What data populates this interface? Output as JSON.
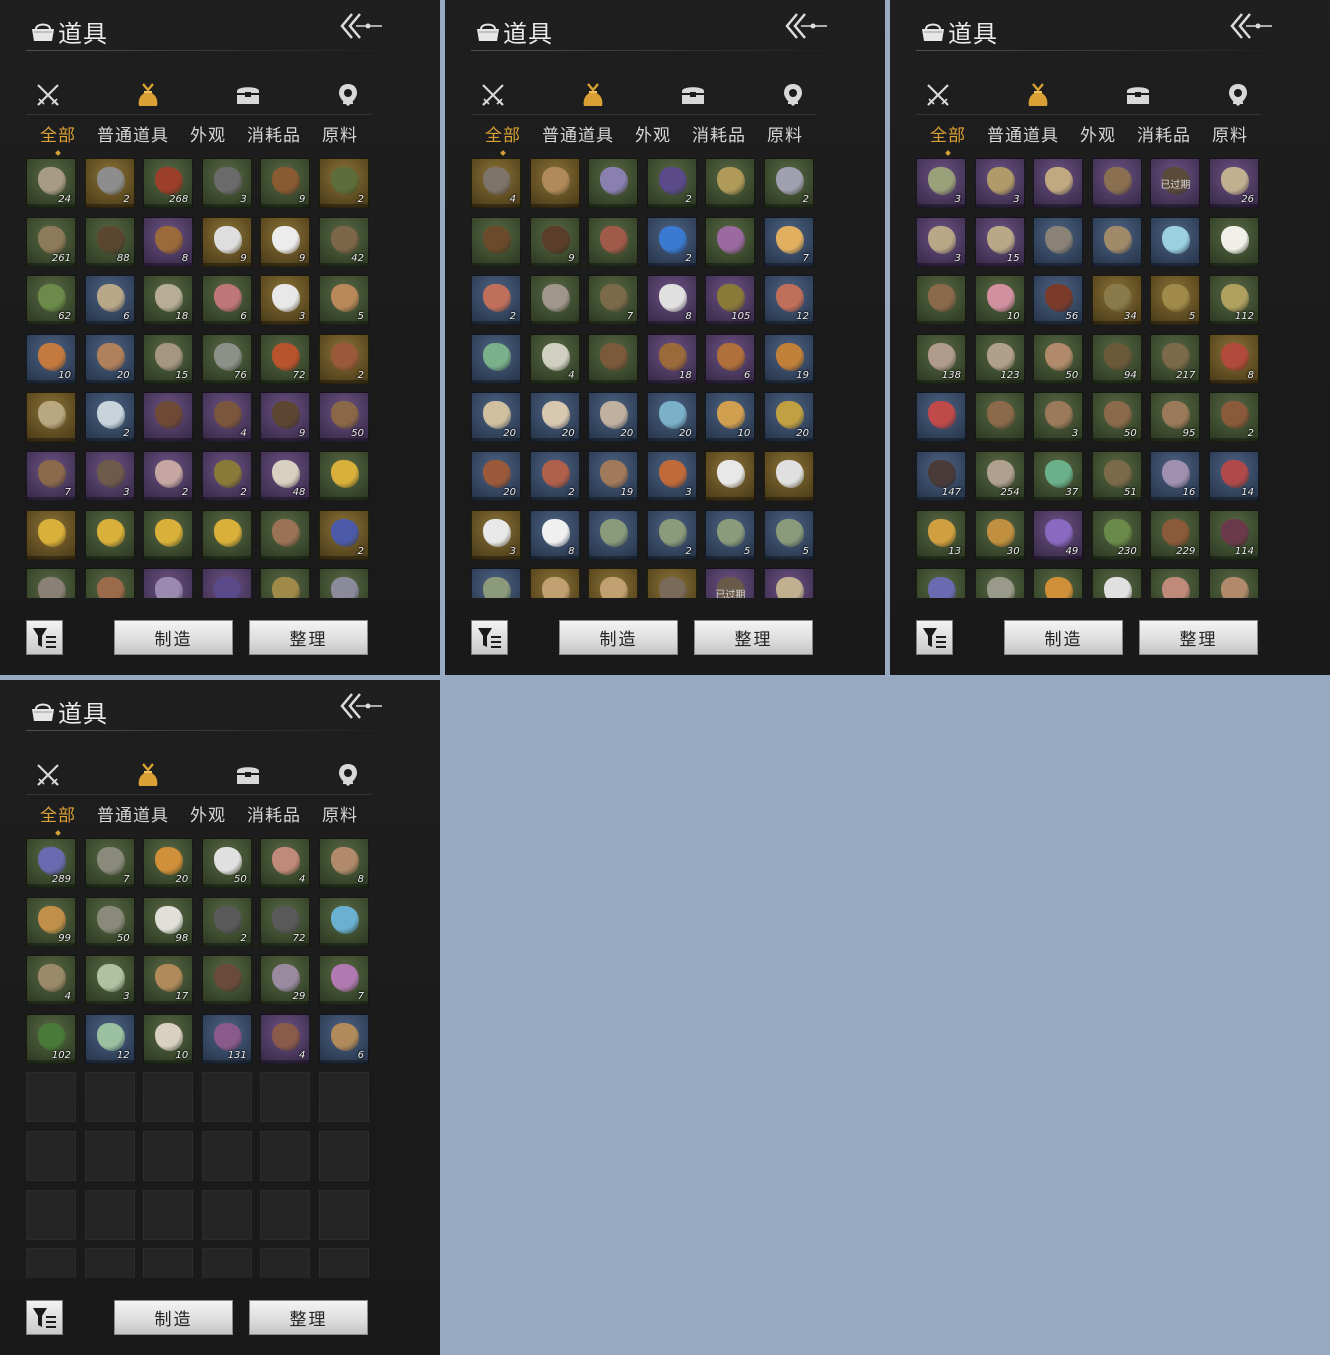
{
  "colors": {
    "background": "#97aac2",
    "panel": "#1c1c1c",
    "accent_gold": "#d9a135",
    "rarity_green": "#3c4a2e",
    "rarity_blue": "#34455f",
    "rarity_purple": "#4a385d",
    "rarity_gold": "#614e22"
  },
  "panels": [
    {
      "title": "道具",
      "back_icon": "double-chevron-left-icon",
      "icon_tabs": [
        "crossed-swords-icon",
        "pouch-icon",
        "chest-icon",
        "pin-icon"
      ],
      "active_icon_tab": 1,
      "tabs": [
        "全部",
        "普通道具",
        "外观",
        "消耗品",
        "原料"
      ],
      "active_tab": 0,
      "craft_label": "制造",
      "sort_label": "整理",
      "filter_icon": "filter-list-icon",
      "items": [
        {
          "r": "green",
          "q": "24",
          "c": "#a89b85"
        },
        {
          "r": "gold",
          "q": "2",
          "c": "#8d8d8d"
        },
        {
          "r": "green",
          "q": "268",
          "c": "#9b3f2a"
        },
        {
          "r": "green",
          "q": "3",
          "c": "#6b6b6b"
        },
        {
          "r": "green",
          "q": "9",
          "c": "#8a5a33"
        },
        {
          "r": "gold",
          "q": "2",
          "c": "#5e6e3a"
        },
        {
          "r": "green",
          "q": "261",
          "c": "#8d7a5a"
        },
        {
          "r": "green",
          "q": "88",
          "c": "#5b4730"
        },
        {
          "r": "purple",
          "q": "8",
          "c": "#9b6a3a"
        },
        {
          "r": "gold",
          "q": "9",
          "c": "#dedede"
        },
        {
          "r": "gold",
          "q": "9",
          "c": "#ececec"
        },
        {
          "r": "green",
          "q": "42",
          "c": "#7d6547"
        },
        {
          "r": "green",
          "q": "62",
          "c": "#6c8a4a"
        },
        {
          "r": "blue",
          "q": "6",
          "c": "#b8a789"
        },
        {
          "r": "green",
          "q": "18",
          "c": "#b6ad94"
        },
        {
          "r": "green",
          "q": "6",
          "c": "#c07777"
        },
        {
          "r": "gold",
          "q": "3",
          "c": "#e8e8e8"
        },
        {
          "r": "green",
          "q": "5",
          "c": "#b8875a"
        },
        {
          "r": "blue",
          "q": "10",
          "c": "#c47a3f"
        },
        {
          "r": "blue",
          "q": "20",
          "c": "#b0805a"
        },
        {
          "r": "green",
          "q": "15",
          "c": "#a49680"
        },
        {
          "r": "green",
          "q": "76",
          "c": "#8c9088"
        },
        {
          "r": "green",
          "q": "72",
          "c": "#b8542d"
        },
        {
          "r": "gold",
          "q": "2",
          "c": "#9a5a3a"
        },
        {
          "r": "gold",
          "q": "",
          "c": "#b9a780"
        },
        {
          "r": "blue",
          "q": "2",
          "c": "#c8d3dc"
        },
        {
          "r": "purple",
          "q": "",
          "c": "#6e4a36"
        },
        {
          "r": "purple",
          "q": "4",
          "c": "#7a563d"
        },
        {
          "r": "purple",
          "q": "9",
          "c": "#5d4631"
        },
        {
          "r": "purple",
          "q": "50",
          "c": "#8a6747"
        },
        {
          "r": "purple",
          "q": "7",
          "c": "#8a6a4a"
        },
        {
          "r": "purple",
          "q": "3",
          "c": "#6d5a4b"
        },
        {
          "r": "purple",
          "q": "2",
          "c": "#c5a6a0"
        },
        {
          "r": "purple",
          "q": "2",
          "c": "#8a7a3a"
        },
        {
          "r": "purple",
          "q": "48",
          "c": "#d8d0c0"
        },
        {
          "r": "green",
          "q": "",
          "c": "#d8b03a"
        },
        {
          "r": "gold",
          "q": "",
          "c": "#d8b03a"
        },
        {
          "r": "green",
          "q": "",
          "c": "#d8b03a"
        },
        {
          "r": "green",
          "q": "",
          "c": "#d8b03a"
        },
        {
          "r": "green",
          "q": "",
          "c": "#d8b03a"
        },
        {
          "r": "green",
          "q": "",
          "c": "#9a7255"
        },
        {
          "r": "gold",
          "q": "2",
          "c": "#4a5aa8"
        },
        {
          "r": "green",
          "q": "",
          "c": "#8a8076"
        },
        {
          "r": "green",
          "q": "",
          "c": "#9a6a4a"
        },
        {
          "r": "purple",
          "q": "",
          "c": "#9a8ab0"
        },
        {
          "r": "purple",
          "q": "",
          "c": "#5a4a8a"
        },
        {
          "r": "green",
          "q": "",
          "c": "#a08a4a"
        },
        {
          "r": "green",
          "q": "",
          "c": "#8a8a9a"
        }
      ]
    },
    {
      "title": "道具",
      "back_icon": "double-chevron-left-icon",
      "icon_tabs": [
        "crossed-swords-icon",
        "pouch-icon",
        "chest-icon",
        "pin-icon"
      ],
      "active_icon_tab": 1,
      "tabs": [
        "全部",
        "普通道具",
        "外观",
        "消耗品",
        "原料"
      ],
      "active_tab": 0,
      "craft_label": "制造",
      "sort_label": "整理",
      "filter_icon": "filter-list-icon",
      "items": [
        {
          "r": "gold",
          "q": "4",
          "c": "#7c7468"
        },
        {
          "r": "gold",
          "q": "",
          "c": "#b08a5a"
        },
        {
          "r": "green",
          "q": "",
          "c": "#8a80b0"
        },
        {
          "r": "green",
          "q": "2",
          "c": "#5a4a8a"
        },
        {
          "r": "green",
          "q": "",
          "c": "#b09a5a"
        },
        {
          "r": "green",
          "q": "2",
          "c": "#a0a0b0"
        },
        {
          "r": "green",
          "q": "",
          "c": "#6a4a2a"
        },
        {
          "r": "green",
          "q": "9",
          "c": "#5a3e2a"
        },
        {
          "r": "green",
          "q": "",
          "c": "#a05a4a"
        },
        {
          "r": "blue",
          "q": "2",
          "c": "#3a7ad0"
        },
        {
          "r": "green",
          "q": "",
          "c": "#9a6aa0"
        },
        {
          "r": "blue",
          "q": "7",
          "c": "#e0b060"
        },
        {
          "r": "blue",
          "q": "2",
          "c": "#c0705a"
        },
        {
          "r": "green",
          "q": "",
          "c": "#a0968a"
        },
        {
          "r": "green",
          "q": "7",
          "c": "#7a6a4a"
        },
        {
          "r": "purple",
          "q": "8",
          "c": "#e0e0e0"
        },
        {
          "r": "purple",
          "q": "105",
          "c": "#8a7a3a"
        },
        {
          "r": "blue",
          "q": "12",
          "c": "#c0705a"
        },
        {
          "r": "blue",
          "q": "",
          "c": "#7ab08a"
        },
        {
          "r": "green",
          "q": "4",
          "c": "#d0d0c0"
        },
        {
          "r": "green",
          "q": "",
          "c": "#7a5a3a"
        },
        {
          "r": "purple",
          "q": "18",
          "c": "#9a6a3a"
        },
        {
          "r": "purple",
          "q": "6",
          "c": "#b0703a"
        },
        {
          "r": "blue",
          "q": "19",
          "c": "#c0803a"
        },
        {
          "r": "blue",
          "q": "20",
          "c": "#d0c0a0"
        },
        {
          "r": "blue",
          "q": "20",
          "c": "#d8c8b0"
        },
        {
          "r": "blue",
          "q": "20",
          "c": "#c0b0a0"
        },
        {
          "r": "blue",
          "q": "20",
          "c": "#7ab0c8"
        },
        {
          "r": "blue",
          "q": "10",
          "c": "#d0a050"
        },
        {
          "r": "blue",
          "q": "20",
          "c": "#c0a040"
        },
        {
          "r": "blue",
          "q": "20",
          "c": "#9a5a3a"
        },
        {
          "r": "blue",
          "q": "2",
          "c": "#b0604a"
        },
        {
          "r": "blue",
          "q": "19",
          "c": "#a07a5a"
        },
        {
          "r": "blue",
          "q": "3",
          "c": "#c06a3a"
        },
        {
          "r": "gold",
          "q": "",
          "c": "#e8e8e8"
        },
        {
          "r": "gold",
          "q": "",
          "c": "#e0e0e0"
        },
        {
          "r": "gold",
          "q": "3",
          "c": "#e8e8e8"
        },
        {
          "r": "blue",
          "q": "8",
          "c": "#f0f0f0"
        },
        {
          "r": "blue",
          "q": "",
          "c": "#8a9a7a"
        },
        {
          "r": "blue",
          "q": "2",
          "c": "#8a9a7a"
        },
        {
          "r": "blue",
          "q": "5",
          "c": "#8a9a7a"
        },
        {
          "r": "blue",
          "q": "5",
          "c": "#8a9a7a"
        },
        {
          "r": "blue",
          "q": "",
          "c": "#8a9a7a"
        },
        {
          "r": "gold",
          "q": "",
          "c": "#c0a070"
        },
        {
          "r": "gold",
          "q": "",
          "c": "#c0a070"
        },
        {
          "r": "gold",
          "q": "",
          "c": "#7a6a5a"
        },
        {
          "r": "purple",
          "q": "",
          "c": "#6a5a4a",
          "x": "已过期"
        },
        {
          "r": "purple",
          "q": "",
          "c": "#c0b090"
        }
      ]
    },
    {
      "title": "道具",
      "back_icon": "double-chevron-left-icon",
      "icon_tabs": [
        "crossed-swords-icon",
        "pouch-icon",
        "chest-icon",
        "pin-icon"
      ],
      "active_icon_tab": 1,
      "tabs": [
        "全部",
        "普通道具",
        "外观",
        "消耗品",
        "原料"
      ],
      "active_tab": 0,
      "craft_label": "制造",
      "sort_label": "整理",
      "filter_icon": "filter-list-icon",
      "items": [
        {
          "r": "purple",
          "q": "3",
          "c": "#9aa07a"
        },
        {
          "r": "purple",
          "q": "3",
          "c": "#b09a6a"
        },
        {
          "r": "purple",
          "q": "",
          "c": "#c0a880"
        },
        {
          "r": "purple",
          "q": "",
          "c": "#8a7050"
        },
        {
          "r": "purple",
          "q": "",
          "c": "#5a4a3a",
          "x": "已过期"
        },
        {
          "r": "purple",
          "q": "26",
          "c": "#c0b090"
        },
        {
          "r": "purple",
          "q": "3",
          "c": "#b8a888"
        },
        {
          "r": "purple",
          "q": "15",
          "c": "#b8a888"
        },
        {
          "r": "blue",
          "q": "",
          "c": "#8a8276"
        },
        {
          "r": "blue",
          "q": "",
          "c": "#a08a6a"
        },
        {
          "r": "blue",
          "q": "",
          "c": "#9ad0e0"
        },
        {
          "r": "green",
          "q": "",
          "c": "#f0f0e8"
        },
        {
          "r": "green",
          "q": "",
          "c": "#8a6a4a"
        },
        {
          "r": "green",
          "q": "10",
          "c": "#d090a0"
        },
        {
          "r": "blue",
          "q": "56",
          "c": "#7a3a2a"
        },
        {
          "r": "gold",
          "q": "34",
          "c": "#8a7a4a"
        },
        {
          "r": "gold",
          "q": "5",
          "c": "#a08a4a"
        },
        {
          "r": "green",
          "q": "112",
          "c": "#b0a060"
        },
        {
          "r": "green",
          "q": "138",
          "c": "#b09a8a"
        },
        {
          "r": "green",
          "q": "123",
          "c": "#b0a08a"
        },
        {
          "r": "green",
          "q": "50",
          "c": "#b08a6a"
        },
        {
          "r": "green",
          "q": "94",
          "c": "#6a5a3a"
        },
        {
          "r": "green",
          "q": "217",
          "c": "#7a6a4a"
        },
        {
          "r": "gold",
          "q": "8",
          "c": "#b04a3a"
        },
        {
          "r": "blue",
          "q": "",
          "c": "#c04a4a"
        },
        {
          "r": "green",
          "q": "",
          "c": "#8a6a4a"
        },
        {
          "r": "green",
          "q": "3",
          "c": "#9a7a5a"
        },
        {
          "r": "green",
          "q": "50",
          "c": "#8a6a4a"
        },
        {
          "r": "green",
          "q": "95",
          "c": "#9a7a5a"
        },
        {
          "r": "green",
          "q": "2",
          "c": "#8a5a3a"
        },
        {
          "r": "blue",
          "q": "147",
          "c": "#4a3a3a"
        },
        {
          "r": "green",
          "q": "254",
          "c": "#b0a090"
        },
        {
          "r": "green",
          "q": "37",
          "c": "#6ab08a"
        },
        {
          "r": "green",
          "q": "51",
          "c": "#7a6a4a"
        },
        {
          "r": "blue",
          "q": "16",
          "c": "#a090b0"
        },
        {
          "r": "blue",
          "q": "14",
          "c": "#b04a4a"
        },
        {
          "r": "green",
          "q": "13",
          "c": "#d0a040"
        },
        {
          "r": "green",
          "q": "30",
          "c": "#c09040"
        },
        {
          "r": "purple",
          "q": "49",
          "c": "#8a6ac0"
        },
        {
          "r": "green",
          "q": "230",
          "c": "#6a8a4a"
        },
        {
          "r": "green",
          "q": "229",
          "c": "#8a5a3a"
        },
        {
          "r": "green",
          "q": "114",
          "c": "#6a3a4a"
        },
        {
          "r": "green",
          "q": "",
          "c": "#6a6ab0"
        },
        {
          "r": "green",
          "q": "",
          "c": "#9a9a8a"
        },
        {
          "r": "green",
          "q": "",
          "c": "#d0903a"
        },
        {
          "r": "green",
          "q": "",
          "c": "#e0e0e0"
        },
        {
          "r": "green",
          "q": "",
          "c": "#c08a7a"
        },
        {
          "r": "green",
          "q": "",
          "c": "#b08a6a"
        }
      ]
    },
    {
      "title": "道具",
      "back_icon": "double-chevron-left-icon",
      "icon_tabs": [
        "crossed-swords-icon",
        "pouch-icon",
        "chest-icon",
        "pin-icon"
      ],
      "active_icon_tab": 1,
      "tabs": [
        "全部",
        "普通道具",
        "外观",
        "消耗品",
        "原料"
      ],
      "active_tab": 0,
      "craft_label": "制造",
      "sort_label": "整理",
      "filter_icon": "filter-list-icon",
      "items": [
        {
          "r": "green",
          "q": "289",
          "c": "#6a6ab0"
        },
        {
          "r": "green",
          "q": "7",
          "c": "#8a8a7a"
        },
        {
          "r": "green",
          "q": "20",
          "c": "#d0903a"
        },
        {
          "r": "green",
          "q": "50",
          "c": "#e0e0e0"
        },
        {
          "r": "green",
          "q": "4",
          "c": "#c08a7a"
        },
        {
          "r": "green",
          "q": "8",
          "c": "#b08a6a"
        },
        {
          "r": "green",
          "q": "99",
          "c": "#c0904a"
        },
        {
          "r": "green",
          "q": "50",
          "c": "#8a8a7a"
        },
        {
          "r": "green",
          "q": "98",
          "c": "#e0e0d8"
        },
        {
          "r": "green",
          "q": "2",
          "c": "#5a5a5a"
        },
        {
          "r": "green",
          "q": "72",
          "c": "#5a5a5a"
        },
        {
          "r": "green",
          "q": "",
          "c": "#6ab0d0"
        },
        {
          "r": "green",
          "q": "4",
          "c": "#9a8a6a"
        },
        {
          "r": "green",
          "q": "3",
          "c": "#b0c0a0"
        },
        {
          "r": "green",
          "q": "17",
          "c": "#b08a5a"
        },
        {
          "r": "green",
          "q": "",
          "c": "#6a4a3a"
        },
        {
          "r": "green",
          "q": "29",
          "c": "#9a8aa0"
        },
        {
          "r": "green",
          "q": "7",
          "c": "#b07ab0"
        },
        {
          "r": "green",
          "q": "102",
          "c": "#4a7a3a"
        },
        {
          "r": "blue",
          "q": "12",
          "c": "#9ac0a0"
        },
        {
          "r": "green",
          "q": "10",
          "c": "#d8d0c0"
        },
        {
          "r": "blue",
          "q": "131",
          "c": "#8a5a8a"
        },
        {
          "r": "purple",
          "q": "4",
          "c": "#8a5a4a"
        },
        {
          "r": "blue",
          "q": "6",
          "c": "#b08a5a"
        },
        {
          "r": "empty",
          "q": "",
          "c": ""
        },
        {
          "r": "empty",
          "q": "",
          "c": ""
        },
        {
          "r": "empty",
          "q": "",
          "c": ""
        },
        {
          "r": "empty",
          "q": "",
          "c": ""
        },
        {
          "r": "empty",
          "q": "",
          "c": ""
        },
        {
          "r": "empty",
          "q": "",
          "c": ""
        },
        {
          "r": "empty",
          "q": "",
          "c": ""
        },
        {
          "r": "empty",
          "q": "",
          "c": ""
        },
        {
          "r": "empty",
          "q": "",
          "c": ""
        },
        {
          "r": "empty",
          "q": "",
          "c": ""
        },
        {
          "r": "empty",
          "q": "",
          "c": ""
        },
        {
          "r": "empty",
          "q": "",
          "c": ""
        },
        {
          "r": "empty",
          "q": "",
          "c": ""
        },
        {
          "r": "empty",
          "q": "",
          "c": ""
        },
        {
          "r": "empty",
          "q": "",
          "c": ""
        },
        {
          "r": "empty",
          "q": "",
          "c": ""
        },
        {
          "r": "empty",
          "q": "",
          "c": ""
        },
        {
          "r": "empty",
          "q": "",
          "c": ""
        },
        {
          "r": "empty",
          "q": "",
          "c": ""
        },
        {
          "r": "empty",
          "q": "",
          "c": ""
        },
        {
          "r": "empty",
          "q": "",
          "c": ""
        },
        {
          "r": "empty",
          "q": "",
          "c": ""
        },
        {
          "r": "empty",
          "q": "",
          "c": ""
        },
        {
          "r": "empty",
          "q": "",
          "c": ""
        }
      ]
    }
  ]
}
